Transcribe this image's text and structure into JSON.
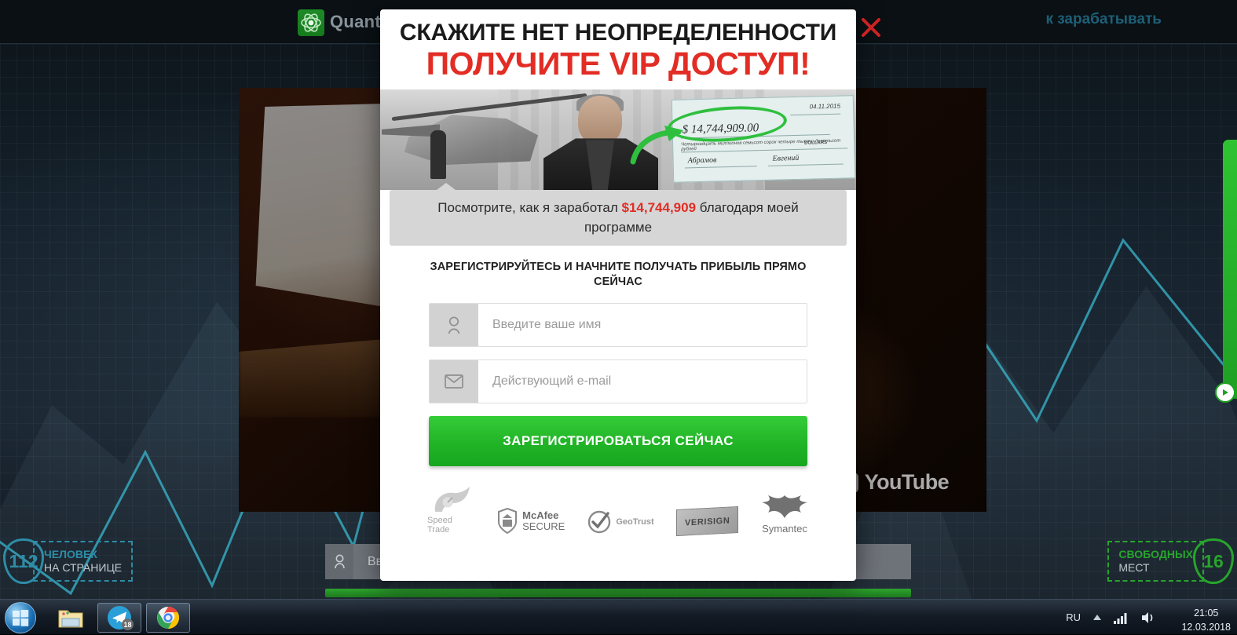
{
  "site": {
    "logo_text": "Quantum",
    "nav_right_text": "к зарабатывать",
    "close_label": "×"
  },
  "video": {
    "youtube_label": "YouTube"
  },
  "background_form": {
    "name_placeholder": "Введите ваше имя"
  },
  "counters": {
    "left": {
      "number": "112",
      "bold_text": "ЧЕЛОВЕК",
      "normal_text": "НА СТРАНИЦЕ",
      "color": "#2e8ca6"
    },
    "right": {
      "number": "16",
      "bold_text": "СВОБОДНЫХ",
      "normal_text": "МЕСТ",
      "color": "#27a52c"
    }
  },
  "modal": {
    "headline_top": "СКАЖИТЕ НЕТ НЕОПРЕДЕЛЕННОСТИ",
    "headline_bottom": "ПОЛУЧИТЕ VIP ДОСТУП!",
    "headline_bottom_color": "#e22d25",
    "check": {
      "amount": "$ 14,744,909.00",
      "date": "04.11.2015",
      "words": "Четырнадцать миллионов семьсот сорок четыре тысячи девятьсот рублей",
      "signature_first": "Абрамов",
      "signature_second": "Евгений",
      "dollars_label": "DOLLARS"
    },
    "caption_before": "Посмотрите, как я заработал ",
    "caption_highlight": "$14,744,909",
    "caption_after": " благодаря моей программе",
    "subheadline": "ЗАРЕГИСТРИРУЙТЕСЬ И НАЧНИТЕ ПОЛУЧАТЬ ПРИБЫЛЬ ПРЯМО СЕЙЧАС",
    "form": {
      "name_placeholder": "Введите ваше имя",
      "name_value": "",
      "email_placeholder": "Действующий e-mail",
      "email_value": "",
      "submit_label": "ЗАРЕГИСТРИРОВАТЬСЯ СЕЙЧАС",
      "submit_color": "#22b528"
    },
    "badges": [
      {
        "name": "speed-trade",
        "label": "Speed Trade"
      },
      {
        "name": "mcafee-secure",
        "label": "McAfee",
        "label2": "SECURE"
      },
      {
        "name": "geotrust",
        "label": "GeoTrust"
      },
      {
        "name": "verisign",
        "label": "VERISIGN"
      },
      {
        "name": "symantec",
        "label": "Symantec"
      }
    ]
  },
  "taskbar": {
    "items": [
      {
        "name": "start-orb",
        "label": ""
      },
      {
        "name": "explorer",
        "label": ""
      },
      {
        "name": "telegram",
        "label": "",
        "badge": "18"
      },
      {
        "name": "chrome",
        "label": ""
      }
    ],
    "tray_language": "RU",
    "clock_time": "21:05",
    "clock_date": "12.03.2018"
  }
}
